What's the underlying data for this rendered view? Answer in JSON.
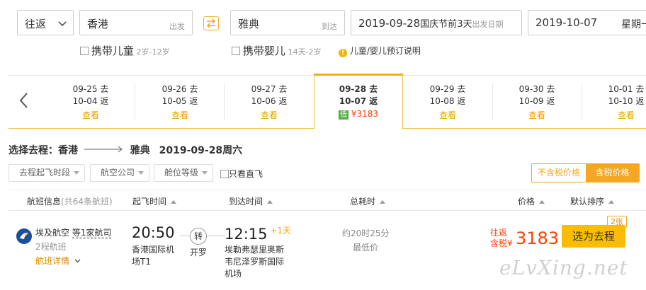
{
  "search": {
    "trip_type": "往返",
    "from_city": "香港",
    "from_hint": "出发",
    "to_city": "雅典",
    "to_hint": "到达",
    "depart_date": "2019-09-28",
    "depart_note": "国庆节前3天",
    "depart_hint": "出发日期",
    "return_date": "2019-10-07",
    "return_weekday": "星期一",
    "child_label": "携带儿童",
    "child_age": "2岁-12岁",
    "infant_label": "携带婴儿",
    "infant_age": "14天-2岁",
    "booking_note": "儿童/婴儿预订说明"
  },
  "date_strip": {
    "view_label": "查看",
    "items": [
      {
        "go": "09-25 去",
        "ret": "10-04 返"
      },
      {
        "go": "09-26 去",
        "ret": "10-05 返"
      },
      {
        "go": "09-27 去",
        "ret": "10-06 返"
      },
      {
        "go": "09-28 去",
        "ret": "10-07 返",
        "badge": "低",
        "price": "¥3183",
        "selected": true
      },
      {
        "go": "09-29 去",
        "ret": "10-08 返"
      },
      {
        "go": "09-30 去",
        "ret": "10-09 返"
      },
      {
        "go": "10-01 去",
        "ret": "10-10 返"
      }
    ]
  },
  "route": {
    "prefix": "选择去程：香港",
    "to": "雅典",
    "date": "2019-09-28周六"
  },
  "filters": {
    "time": "去程起飞时段",
    "airline": "航空公司",
    "cabin": "舱位等级",
    "direct": "只看直飞",
    "tax_excl": "不含税价格",
    "tax_incl": "含税价格"
  },
  "table_header": {
    "flight": "航班信息",
    "count": "(共64条航班)",
    "depart": "起飞时间",
    "arrive": "到达时间",
    "duration": "总耗时",
    "price": "价格",
    "sort": "默认排序"
  },
  "flight": {
    "airline": "埃及航空",
    "codeshare": "等1家航司",
    "legs": "2程航班",
    "details": "航班详情",
    "depart_time": "20:50",
    "depart_airport": "香港国际机场T1",
    "transfer_badge": "转",
    "transfer_city": "开罗",
    "arrive_time": "12:15",
    "day_offset": "+1天",
    "arrive_airport": "埃勒弗瑟里奥斯韦尼泽罗斯国际机场",
    "duration": "约20时25分",
    "lowest": "最低价",
    "round_trip": "往返",
    "tax_included": "含税",
    "currency": "¥",
    "price": "3183",
    "seats": "2张",
    "select_button": "选为去程"
  },
  "watermark": "eLvXing.net",
  "colors": {
    "accent": "#f5a623",
    "price_red": "#ff3d00",
    "link_blue": "#2a7ae2",
    "button_yellow": "#fbbc05"
  }
}
